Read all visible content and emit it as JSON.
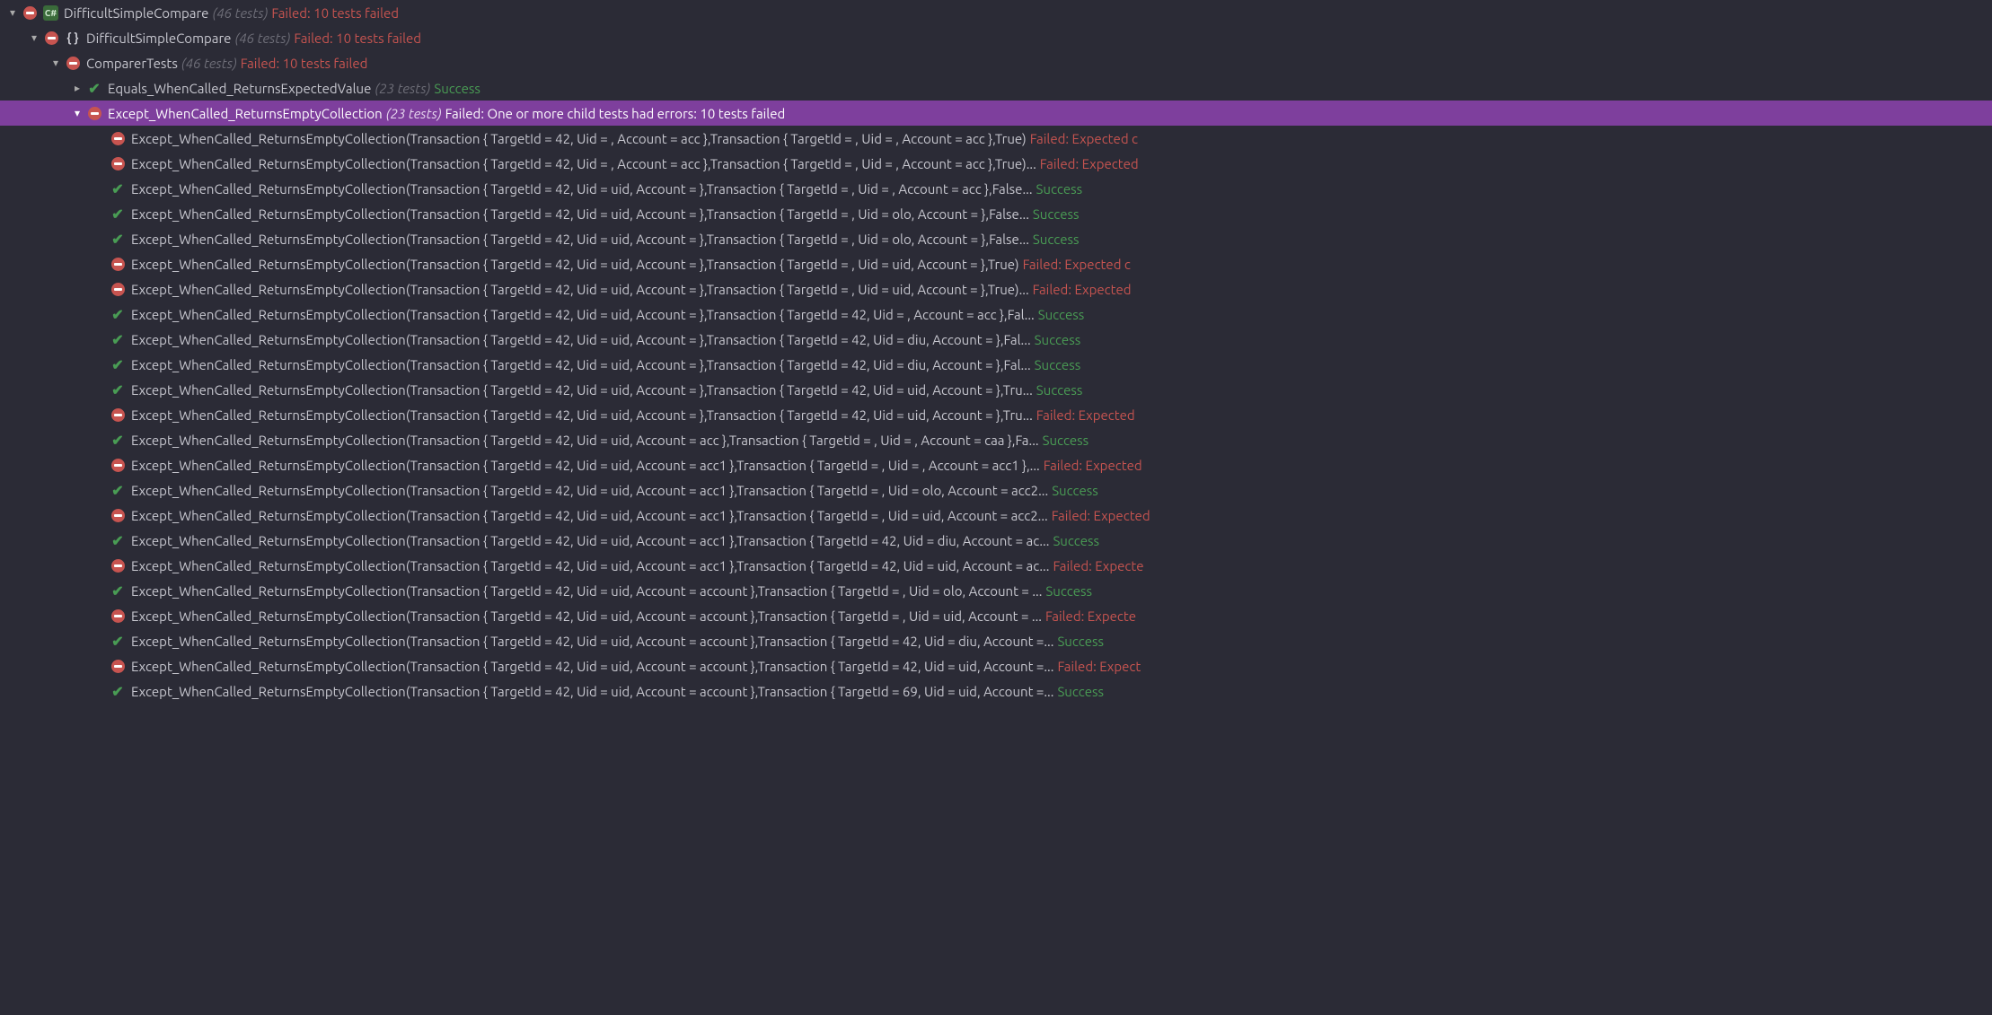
{
  "root": {
    "label": "DifficultSimpleCompare",
    "count": "(46 tests)",
    "status": "Failed: 10 tests failed"
  },
  "ns": {
    "label": "DifficultSimpleCompare",
    "count": "(46 tests)",
    "status": "Failed: 10 tests failed"
  },
  "cls": {
    "label": "ComparerTests",
    "count": "(46 tests)",
    "status": "Failed: 10 tests failed"
  },
  "group_pass": {
    "label": "Equals_WhenCalled_ReturnsExpectedValue",
    "count": "(23 tests)",
    "status": "Success"
  },
  "group_fail": {
    "label": "Except_WhenCalled_ReturnsEmptyCollection",
    "count": "(23 tests)",
    "status": "Failed: One or more child tests had errors: 10 tests failed"
  },
  "tests": [
    {
      "pass": false,
      "label": "Except_WhenCalled_ReturnsEmptyCollection(Transaction { TargetId = 42, Uid = , Account = acc },Transaction { TargetId = , Uid = , Account = acc },True)",
      "status": "Failed: Expected c"
    },
    {
      "pass": false,
      "label": "Except_WhenCalled_ReturnsEmptyCollection(Transaction { TargetId = 42, Uid = , Account = acc },Transaction { TargetId = , Uid = , Account = acc },True)...",
      "status": "Failed: Expected"
    },
    {
      "pass": true,
      "label": "Except_WhenCalled_ReturnsEmptyCollection(Transaction { TargetId = 42, Uid = uid, Account =  },Transaction { TargetId = , Uid = , Account = acc },False...",
      "status": "Success"
    },
    {
      "pass": true,
      "label": "Except_WhenCalled_ReturnsEmptyCollection(Transaction { TargetId = 42, Uid = uid, Account =  },Transaction { TargetId = , Uid = olo, Account =  },False...",
      "status": "Success"
    },
    {
      "pass": true,
      "label": "Except_WhenCalled_ReturnsEmptyCollection(Transaction { TargetId = 42, Uid = uid, Account =  },Transaction { TargetId = , Uid = olo, Account =  },False...",
      "status": "Success"
    },
    {
      "pass": false,
      "label": "Except_WhenCalled_ReturnsEmptyCollection(Transaction { TargetId = 42, Uid = uid, Account =  },Transaction { TargetId = , Uid = uid, Account =  },True)",
      "status": "Failed: Expected c"
    },
    {
      "pass": false,
      "label": "Except_WhenCalled_ReturnsEmptyCollection(Transaction { TargetId = 42, Uid = uid, Account =  },Transaction { TargetId = , Uid = uid, Account =  },True)...",
      "status": "Failed: Expected"
    },
    {
      "pass": true,
      "label": "Except_WhenCalled_ReturnsEmptyCollection(Transaction { TargetId = 42, Uid = uid, Account =  },Transaction { TargetId = 42, Uid = , Account = acc },Fal...",
      "status": "Success"
    },
    {
      "pass": true,
      "label": "Except_WhenCalled_ReturnsEmptyCollection(Transaction { TargetId = 42, Uid = uid, Account =  },Transaction { TargetId = 42, Uid = diu, Account =  },Fal...",
      "status": "Success"
    },
    {
      "pass": true,
      "label": "Except_WhenCalled_ReturnsEmptyCollection(Transaction { TargetId = 42, Uid = uid, Account =  },Transaction { TargetId = 42, Uid = diu, Account =  },Fal...",
      "status": "Success"
    },
    {
      "pass": true,
      "label": "Except_WhenCalled_ReturnsEmptyCollection(Transaction { TargetId = 42, Uid = uid, Account =  },Transaction { TargetId = 42, Uid = uid, Account =  },Tru...",
      "status": "Success"
    },
    {
      "pass": false,
      "label": "Except_WhenCalled_ReturnsEmptyCollection(Transaction { TargetId = 42, Uid = uid, Account =  },Transaction { TargetId = 42, Uid = uid, Account =  },Tru...",
      "status": "Failed: Expected"
    },
    {
      "pass": true,
      "label": "Except_WhenCalled_ReturnsEmptyCollection(Transaction { TargetId = 42, Uid = uid, Account = acc },Transaction { TargetId = , Uid = , Account = caa },Fa...",
      "status": "Success"
    },
    {
      "pass": false,
      "label": "Except_WhenCalled_ReturnsEmptyCollection(Transaction { TargetId = 42, Uid = uid, Account = acc1 },Transaction { TargetId = , Uid = , Account = acc1 },...",
      "status": "Failed: Expected"
    },
    {
      "pass": true,
      "label": "Except_WhenCalled_ReturnsEmptyCollection(Transaction { TargetId = 42, Uid = uid, Account = acc1 },Transaction { TargetId = , Uid = olo, Account = acc2...",
      "status": "Success"
    },
    {
      "pass": false,
      "label": "Except_WhenCalled_ReturnsEmptyCollection(Transaction { TargetId = 42, Uid = uid, Account = acc1 },Transaction { TargetId = , Uid = uid, Account = acc2...",
      "status": "Failed: Expected"
    },
    {
      "pass": true,
      "label": "Except_WhenCalled_ReturnsEmptyCollection(Transaction { TargetId = 42, Uid = uid, Account = acc1 },Transaction { TargetId = 42, Uid = diu, Account = ac...",
      "status": "Success"
    },
    {
      "pass": false,
      "label": "Except_WhenCalled_ReturnsEmptyCollection(Transaction { TargetId = 42, Uid = uid, Account = acc1 },Transaction { TargetId = 42, Uid = uid, Account = ac...",
      "status": "Failed: Expecte"
    },
    {
      "pass": true,
      "label": "Except_WhenCalled_ReturnsEmptyCollection(Transaction { TargetId = 42, Uid = uid, Account = account },Transaction { TargetId = , Uid = olo, Account =  ...",
      "status": "Success"
    },
    {
      "pass": false,
      "label": "Except_WhenCalled_ReturnsEmptyCollection(Transaction { TargetId = 42, Uid = uid, Account = account },Transaction { TargetId = , Uid = uid, Account =  ...",
      "status": "Failed: Expecte"
    },
    {
      "pass": true,
      "label": "Except_WhenCalled_ReturnsEmptyCollection(Transaction { TargetId = 42, Uid = uid, Account = account },Transaction { TargetId = 42, Uid = diu, Account =...",
      "status": "Success"
    },
    {
      "pass": false,
      "label": "Except_WhenCalled_ReturnsEmptyCollection(Transaction { TargetId = 42, Uid = uid, Account = account },Transaction { TargetId = 42, Uid = uid, Account =...",
      "status": "Failed: Expect"
    },
    {
      "pass": true,
      "label": "Except_WhenCalled_ReturnsEmptyCollection(Transaction { TargetId = 42, Uid = uid, Account = account },Transaction { TargetId = 69, Uid = uid, Account =...",
      "status": "Success"
    }
  ]
}
